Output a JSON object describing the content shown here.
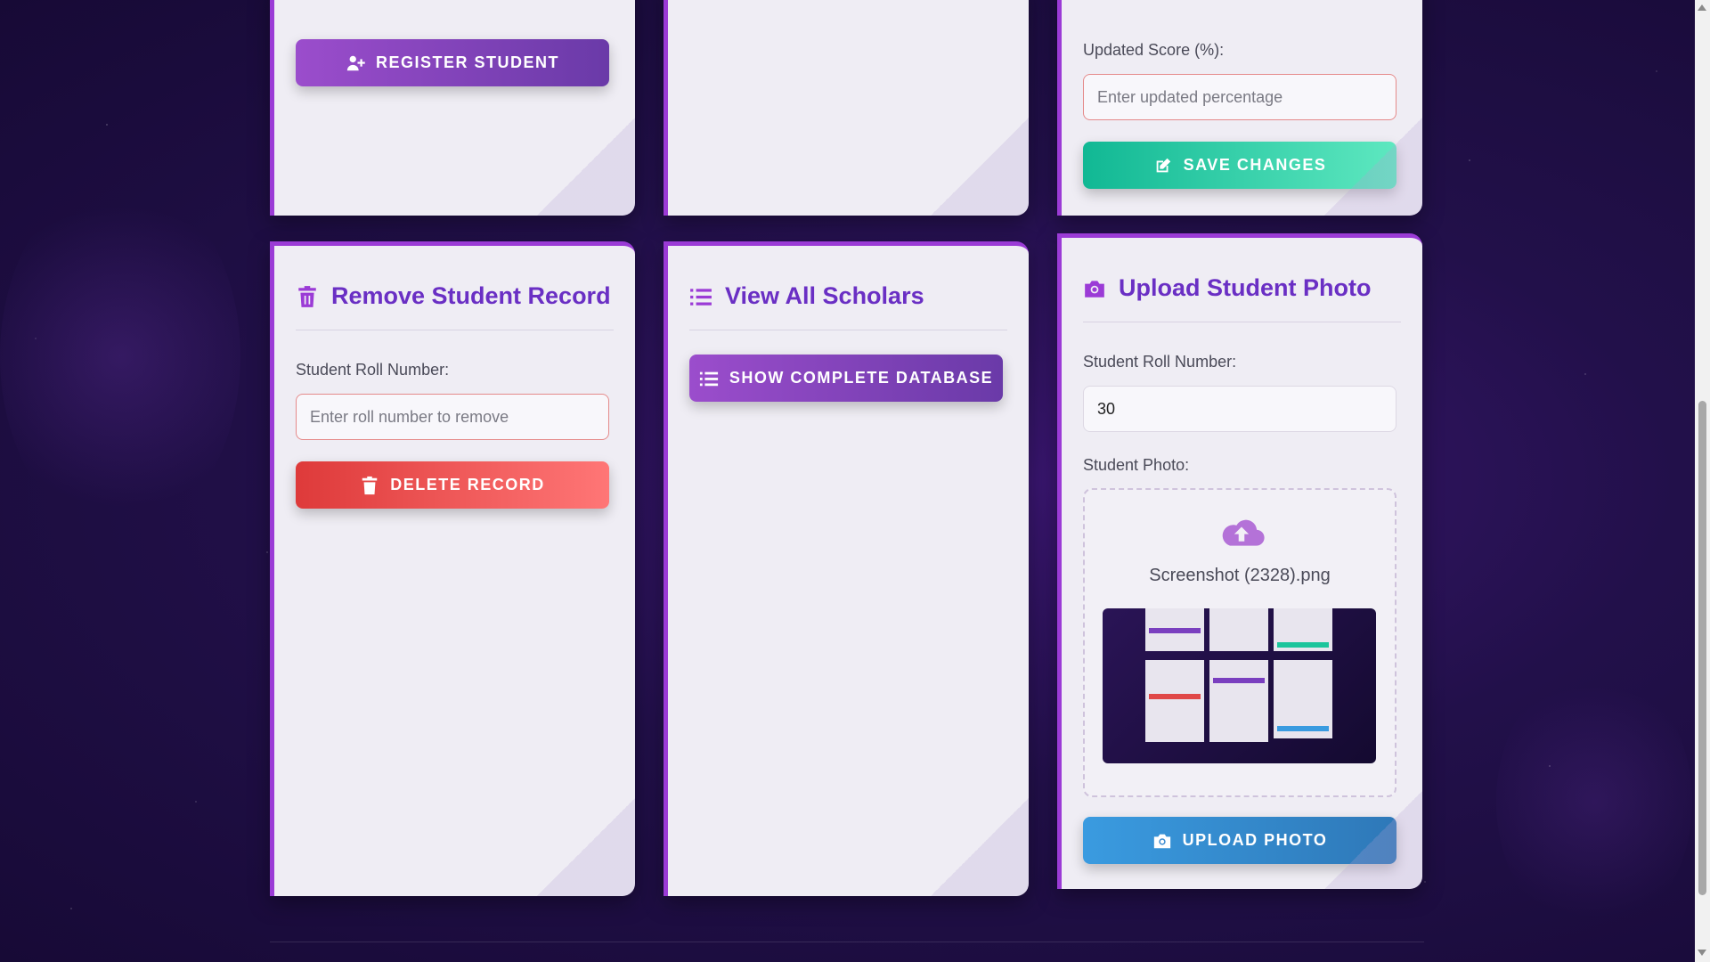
{
  "register_card": {
    "button_label": "REGISTER STUDENT"
  },
  "update_card": {
    "score_label": "Updated Score (%):",
    "score_placeholder": "Enter updated percentage",
    "save_label": "SAVE CHANGES"
  },
  "remove_card": {
    "title": "Remove Student Record",
    "roll_label": "Student Roll Number:",
    "roll_placeholder": "Enter roll number to remove",
    "delete_label": "DELETE RECORD"
  },
  "view_card": {
    "title": "View All Scholars",
    "show_label": "SHOW COMPLETE DATABASE"
  },
  "upload_card": {
    "title": "Upload Student Photo",
    "roll_label": "Student Roll Number:",
    "roll_value": "30",
    "photo_label": "Student Photo:",
    "file_name": "Screenshot (2328).png",
    "upload_label": "UPLOAD PHOTO"
  },
  "icons": {
    "register": "user-plus-icon",
    "save": "edit-icon",
    "remove": "trash-icon",
    "view": "list-icon",
    "upload": "camera-icon",
    "dropzone": "cloud-upload-icon"
  },
  "colors": {
    "accent": "#9b3bd6",
    "title": "#6a2fc4",
    "save": "#11b894",
    "delete": "#de3a3a",
    "upload": "#3a9be0"
  }
}
